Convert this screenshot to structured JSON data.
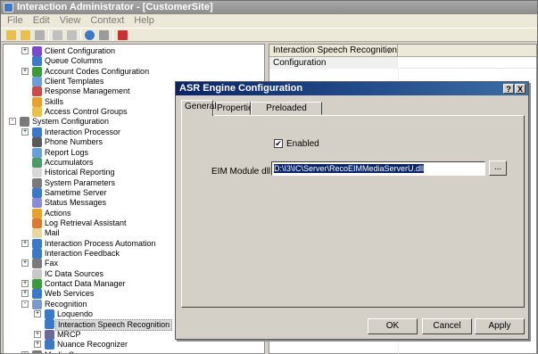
{
  "window": {
    "title": "Interaction Administrator - [CustomerSite]"
  },
  "menu": [
    "File",
    "Edit",
    "View",
    "Context",
    "Help"
  ],
  "colors": {
    "dialog_title": "#0a246a",
    "selection": "#0a246a"
  },
  "tree": [
    {
      "label": "Client Configuration",
      "expander": "+",
      "icon": "config-icon"
    },
    {
      "label": "Queue Columns",
      "expander": "",
      "icon": "queue-icon"
    },
    {
      "label": "Account Codes Configuration",
      "expander": "+",
      "icon": "account-codes-icon"
    },
    {
      "label": "Client Templates",
      "expander": "",
      "icon": "template-icon"
    },
    {
      "label": "Response Management",
      "expander": "",
      "icon": "response-icon"
    },
    {
      "label": "Skills",
      "expander": "",
      "icon": "skills-icon"
    },
    {
      "label": "Access Control Groups",
      "expander": "",
      "icon": "access-icon"
    },
    {
      "label": "System Configuration",
      "expander": "-",
      "icon": "system-config-icon"
    },
    {
      "label": "Interaction Processor",
      "expander": "+",
      "icon": "processor-icon"
    },
    {
      "label": "Phone Numbers",
      "expander": "",
      "icon": "phone-icon"
    },
    {
      "label": "Report Logs",
      "expander": "",
      "icon": "report-icon"
    },
    {
      "label": "Accumulators",
      "expander": "",
      "icon": "accumulator-icon"
    },
    {
      "label": "Historical Reporting",
      "expander": "",
      "icon": "history-icon"
    },
    {
      "label": "System Parameters",
      "expander": "",
      "icon": "parameters-icon"
    },
    {
      "label": "Sametime Server",
      "expander": "",
      "icon": "server-icon"
    },
    {
      "label": "Status Messages",
      "expander": "",
      "icon": "status-icon"
    },
    {
      "label": "Actions",
      "expander": "",
      "icon": "actions-icon"
    },
    {
      "label": "Log Retrieval Assistant",
      "expander": "",
      "icon": "log-icon"
    },
    {
      "label": "Mail",
      "expander": "",
      "icon": "mail-icon"
    },
    {
      "label": "Interaction Process Automation",
      "expander": "+",
      "icon": "automation-icon"
    },
    {
      "label": "Interaction Feedback",
      "expander": "",
      "icon": "feedback-icon"
    },
    {
      "label": "Fax",
      "expander": "+",
      "icon": "fax-icon"
    },
    {
      "label": "IC Data Sources",
      "expander": "",
      "icon": "datasource-icon"
    },
    {
      "label": "Contact Data Manager",
      "expander": "+",
      "icon": "contact-icon"
    },
    {
      "label": "Web Services",
      "expander": "+",
      "icon": "web-icon"
    },
    {
      "label": "Recognition",
      "expander": "-",
      "icon": "recognition-icon"
    },
    {
      "label": "Loquendo",
      "expander": "+",
      "icon": "loquendo-icon"
    },
    {
      "label": "Interaction Speech Recognition",
      "expander": "",
      "icon": "speech-icon"
    },
    {
      "label": "MRCP",
      "expander": "+",
      "icon": "mrcp-icon"
    },
    {
      "label": "Nuance Recognizer",
      "expander": "+",
      "icon": "nuance-icon"
    },
    {
      "label": "Media Servers",
      "expander": "+",
      "icon": "media-icon"
    }
  ],
  "right_pane": {
    "column_header": "Interaction Speech Recognition",
    "sort_glyph": "/",
    "rows": [
      "Configuration"
    ]
  },
  "dialog": {
    "title": "ASR Engine Configuration",
    "help_glyph": "?",
    "close_glyph": "X",
    "tabs": [
      "General",
      "Properties",
      "Preloaded Grammars"
    ],
    "enabled_label": "Enabled",
    "enabled_checked": true,
    "check_glyph": "✔",
    "eim_label": "EIM Module dll:",
    "eim_value": "D:\\I3\\IC\\Server\\RecoEIMMediaServerU.dll",
    "browse_label": "...",
    "ok": "OK",
    "cancel": "Cancel",
    "apply": "Apply"
  }
}
